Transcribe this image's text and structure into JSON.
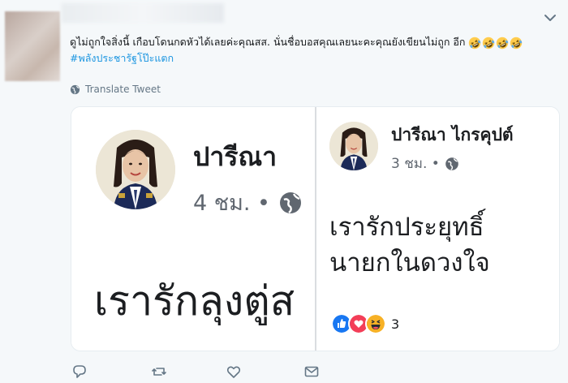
{
  "tweet": {
    "text": "ดูไม่ถูกใจสิ่งนี้ เกือบโดนกดหัวได้เลยค่ะคุณสส. นั่นชื่อบอสคุณเลยนะคะคุณยังเขียนไม่ถูก อีก",
    "emoji_count": 4,
    "hashtag": "#พลังประชารัฐโป๊ะแตก",
    "translate_label": "Translate Tweet",
    "icons": {
      "menu": "chevron-down-icon",
      "translate": "globe-icon",
      "reply": "reply-icon",
      "retweet": "retweet-icon",
      "like": "heart-icon",
      "message": "envelope-icon"
    }
  },
  "left_post": {
    "name": "ปารีณา",
    "time": "4 ชม. •",
    "body": "เรารักลุงตู่ส"
  },
  "right_post": {
    "name": "ปารีณา ไกรคุปต์",
    "time": "3 ชม. •",
    "body_line1": "เรารักประยุทธิ์",
    "body_line2": "นายกในดวงใจ",
    "reactions": [
      "like",
      "love",
      "haha"
    ],
    "reaction_count": "3"
  },
  "colors": {
    "hashtag": "#1b95e0",
    "like": "#1877f2",
    "love": "#f33e58",
    "haha": "#f7b125",
    "muted": "#657786"
  }
}
